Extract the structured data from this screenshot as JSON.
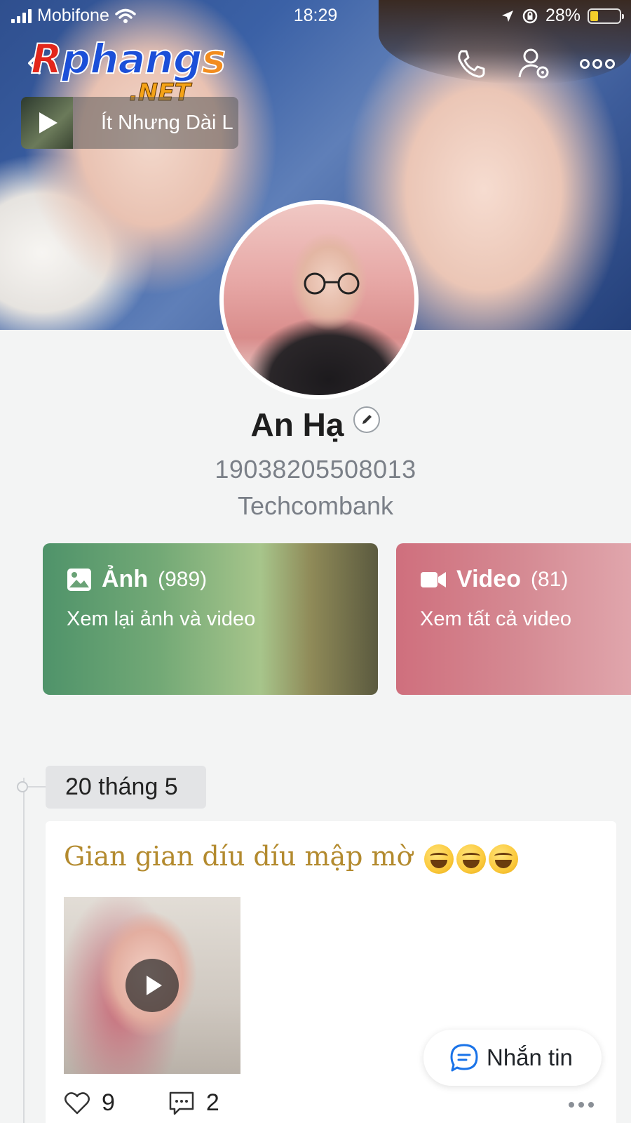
{
  "status_bar": {
    "carrier": "Mobifone",
    "time": "18:29",
    "battery_percent": "28%",
    "battery_level": 0.28,
    "battery_color": "#f5cf2b"
  },
  "watermark": {
    "brand_r": "R",
    "brand_main": "phang",
    "brand_s": "s",
    "brand_net": ".NET"
  },
  "top_bar": {
    "icons": [
      "back-icon",
      "phone-icon",
      "user-settings-icon",
      "more-icon"
    ]
  },
  "music": {
    "title": "Ít Nhưng Dài L"
  },
  "profile": {
    "name": "An Hạ",
    "account_number": "19038205508013",
    "bank": "Techcombank"
  },
  "media_cards": {
    "photos": {
      "title": "Ảnh",
      "count": "(989)",
      "subtitle": "Xem lại ảnh và video"
    },
    "videos": {
      "title": "Video",
      "count": "(81)",
      "subtitle": "Xem tất cả video"
    }
  },
  "timeline": {
    "date": "20 tháng 5"
  },
  "post": {
    "text": "Gian gian díu díu mập mờ",
    "emoji_count": 3,
    "likes": "9",
    "comments": "2"
  },
  "message_button": {
    "label": "Nhắn tin"
  },
  "colors": {
    "photos_card": "#73a976",
    "videos_card": "#d58a93",
    "post_text": "#b38a2e",
    "accent_blue": "#1a73e8"
  }
}
